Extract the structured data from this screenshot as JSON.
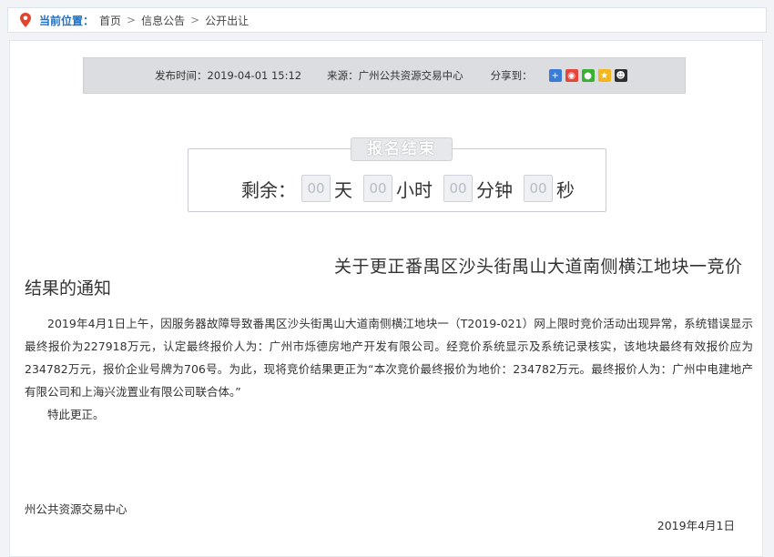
{
  "breadcrumb": {
    "label": "当前位置：",
    "items": [
      "首页",
      "信息公告",
      "公开出让"
    ]
  },
  "meta": {
    "publish_time": "发布时间：2019-04-01 15:12",
    "source": "来源：广州公共资源交易中心",
    "share_label": "分享到："
  },
  "share_icons": [
    "qzone-plus-icon",
    "weibo-icon",
    "wechat-icon",
    "star-icon",
    "qq-icon"
  ],
  "countdown": {
    "status": "报名结束",
    "prefix": "剩余：",
    "days": "00",
    "days_unit": "天",
    "hours": "00",
    "hours_unit": "小时",
    "minutes": "00",
    "minutes_unit": "分钟",
    "seconds": "00",
    "seconds_unit": "秒"
  },
  "article": {
    "title_line1": "关于更正番禺区沙头街禺山大道南侧横江地块一竞价",
    "title_line2": "结果的通知",
    "paragraph": "2019年4月1日上午，因服务器故障导致番禺区沙头街禺山大道南侧横江地块一（T2019-021）网上限时竞价活动出现异常，系统错误显示最终报价为227918万元，认定最终报价人为：广州市烁德房地产开发有限公司。经竞价系统显示及系统记录核实，该地块最终有效报价应为234782万元，报价企业号牌为706号。为此，现将竞价结果更正为“本次竞价最终报价为地价：234782万元。最终报价人为：广州中电建地产有限公司和上海兴泷置业有限公司联合体。”",
    "closing": "特此更正。",
    "org": "州公共资源交易中心",
    "date": "2019年4月1日"
  }
}
